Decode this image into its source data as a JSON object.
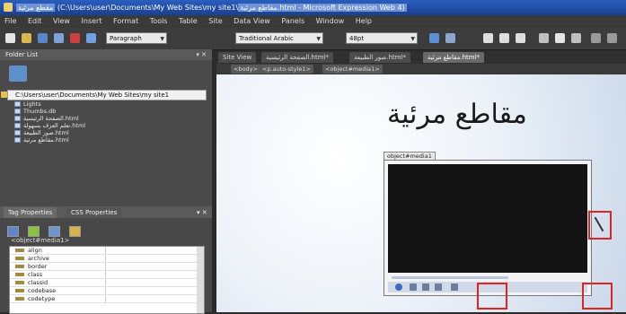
{
  "window": {
    "title_prefix": "مقطع مرئية",
    "title_path": "(C:\\Users\\user\\Documents\\My Web Sites\\my site1\\",
    "title_file": "مقاطع مرئية.html - Microsoft Expression Web 4)"
  },
  "menu": [
    "File",
    "Edit",
    "View",
    "Insert",
    "Format",
    "Tools",
    "Table",
    "Site",
    "Data View",
    "Panels",
    "Window",
    "Help"
  ],
  "toolbar": {
    "style_select": "Paragraph",
    "font_select": "Traditional Arabic",
    "size_select": "48pt"
  },
  "folder_panel": {
    "title": "Folder List",
    "root_path": "C:\\Users\\user\\Documents\\My Web Sites\\my site1",
    "items": [
      {
        "label": "Lights"
      },
      {
        "label": "Thumbs.db"
      },
      {
        "label": "الصفحة الرئيسية.html"
      },
      {
        "label": "تعلم العزف بسهولة.html"
      },
      {
        "label": "صور الطبيعة.html"
      },
      {
        "label": "مقاطع مرئية.html"
      }
    ]
  },
  "tag_panel": {
    "tabs": [
      "Tag Properties",
      "CSS Properties"
    ],
    "tag_label": "<object#media1>",
    "properties": [
      "align",
      "archive",
      "border",
      "class",
      "classid",
      "codebase",
      "codetype"
    ]
  },
  "editor": {
    "tabs": [
      {
        "label": "Site View"
      },
      {
        "label": "الصفحة الرئيسية.html*"
      },
      {
        "label": "صور الطبيعة.html*"
      },
      {
        "label": "مقاطع مرئية.html*",
        "active": true
      }
    ],
    "breadcrumb": [
      "<body>",
      "<p.auto-style1>",
      "<object#media1>"
    ],
    "heading": "مقاطع مرئية",
    "video_tag": "object#media1"
  },
  "colors": {
    "titlebar": "#2a5fbe",
    "highlight_box": "#e02424",
    "video_screen": "#141414"
  }
}
